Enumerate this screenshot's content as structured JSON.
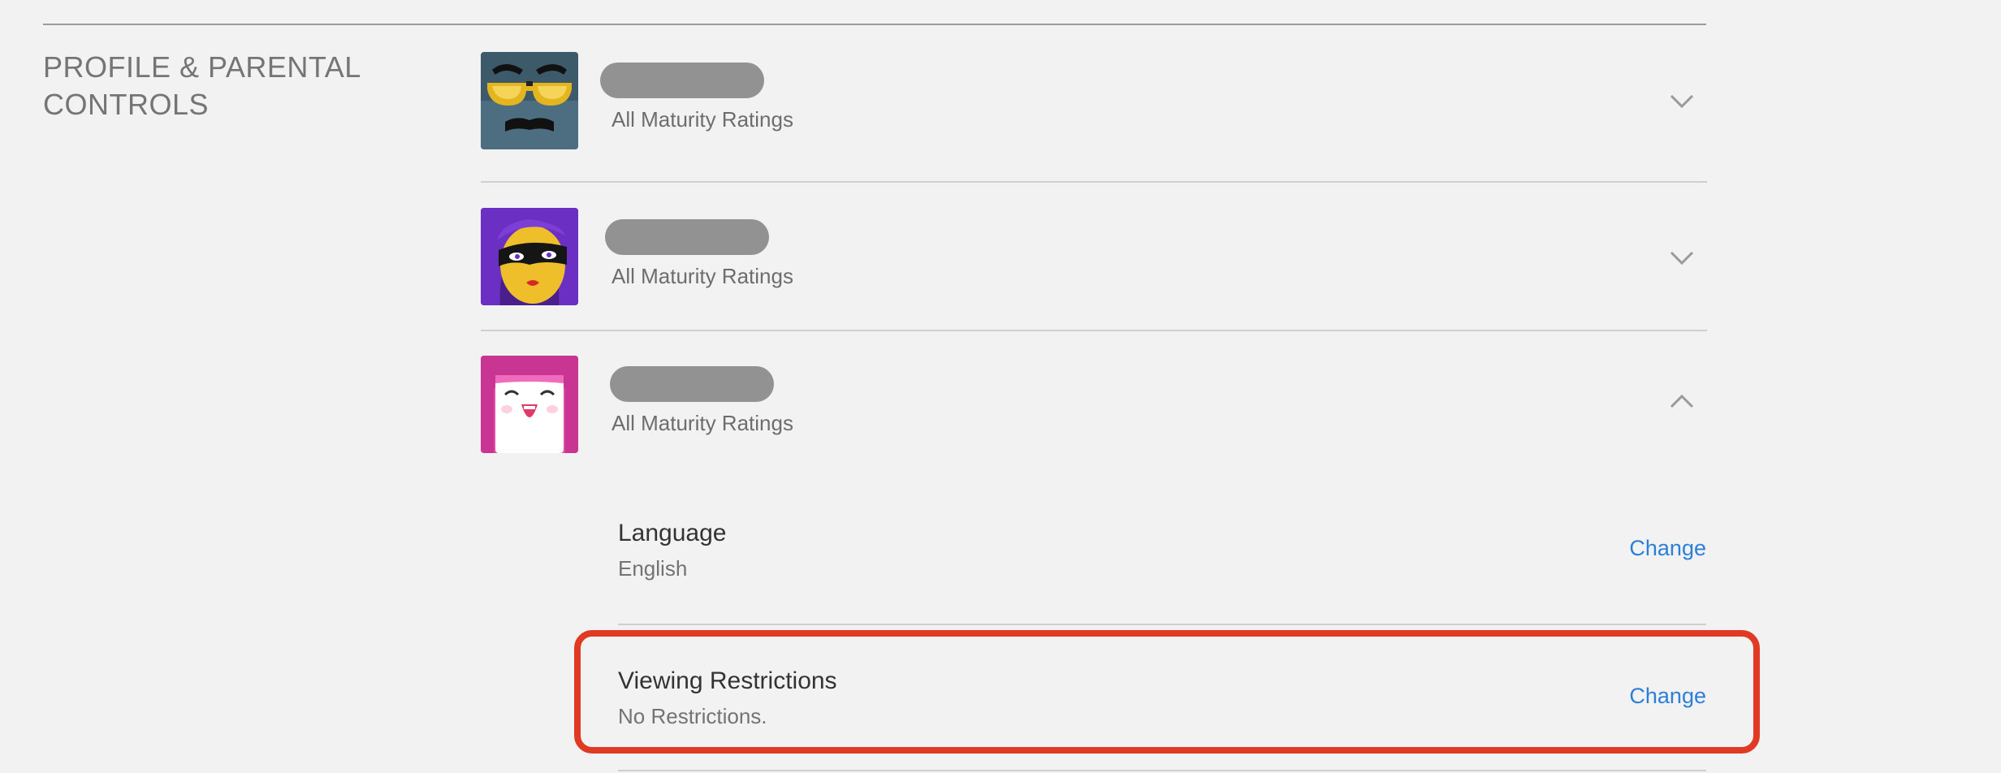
{
  "section": {
    "title": "PROFILE & PARENTAL CONTROLS"
  },
  "profiles": [
    {
      "avatar_icon": "sunglasses-mustache-avatar-icon",
      "name": "",
      "rating": "All Maturity Ratings",
      "expanded": false
    },
    {
      "avatar_icon": "masked-woman-avatar-icon",
      "name": "",
      "rating": "All Maturity Ratings",
      "expanded": false
    },
    {
      "avatar_icon": "pink-hair-laughing-avatar-icon",
      "name": "",
      "rating": "All Maturity Ratings",
      "expanded": true
    }
  ],
  "settings": [
    {
      "label": "Language",
      "value": "English",
      "action": "Change"
    },
    {
      "label": "Viewing Restrictions",
      "value": "No Restrictions.",
      "action": "Change"
    }
  ],
  "colors": {
    "highlight": "#e03a24",
    "link": "#2c7fd8",
    "background": "#f2f2f2"
  }
}
